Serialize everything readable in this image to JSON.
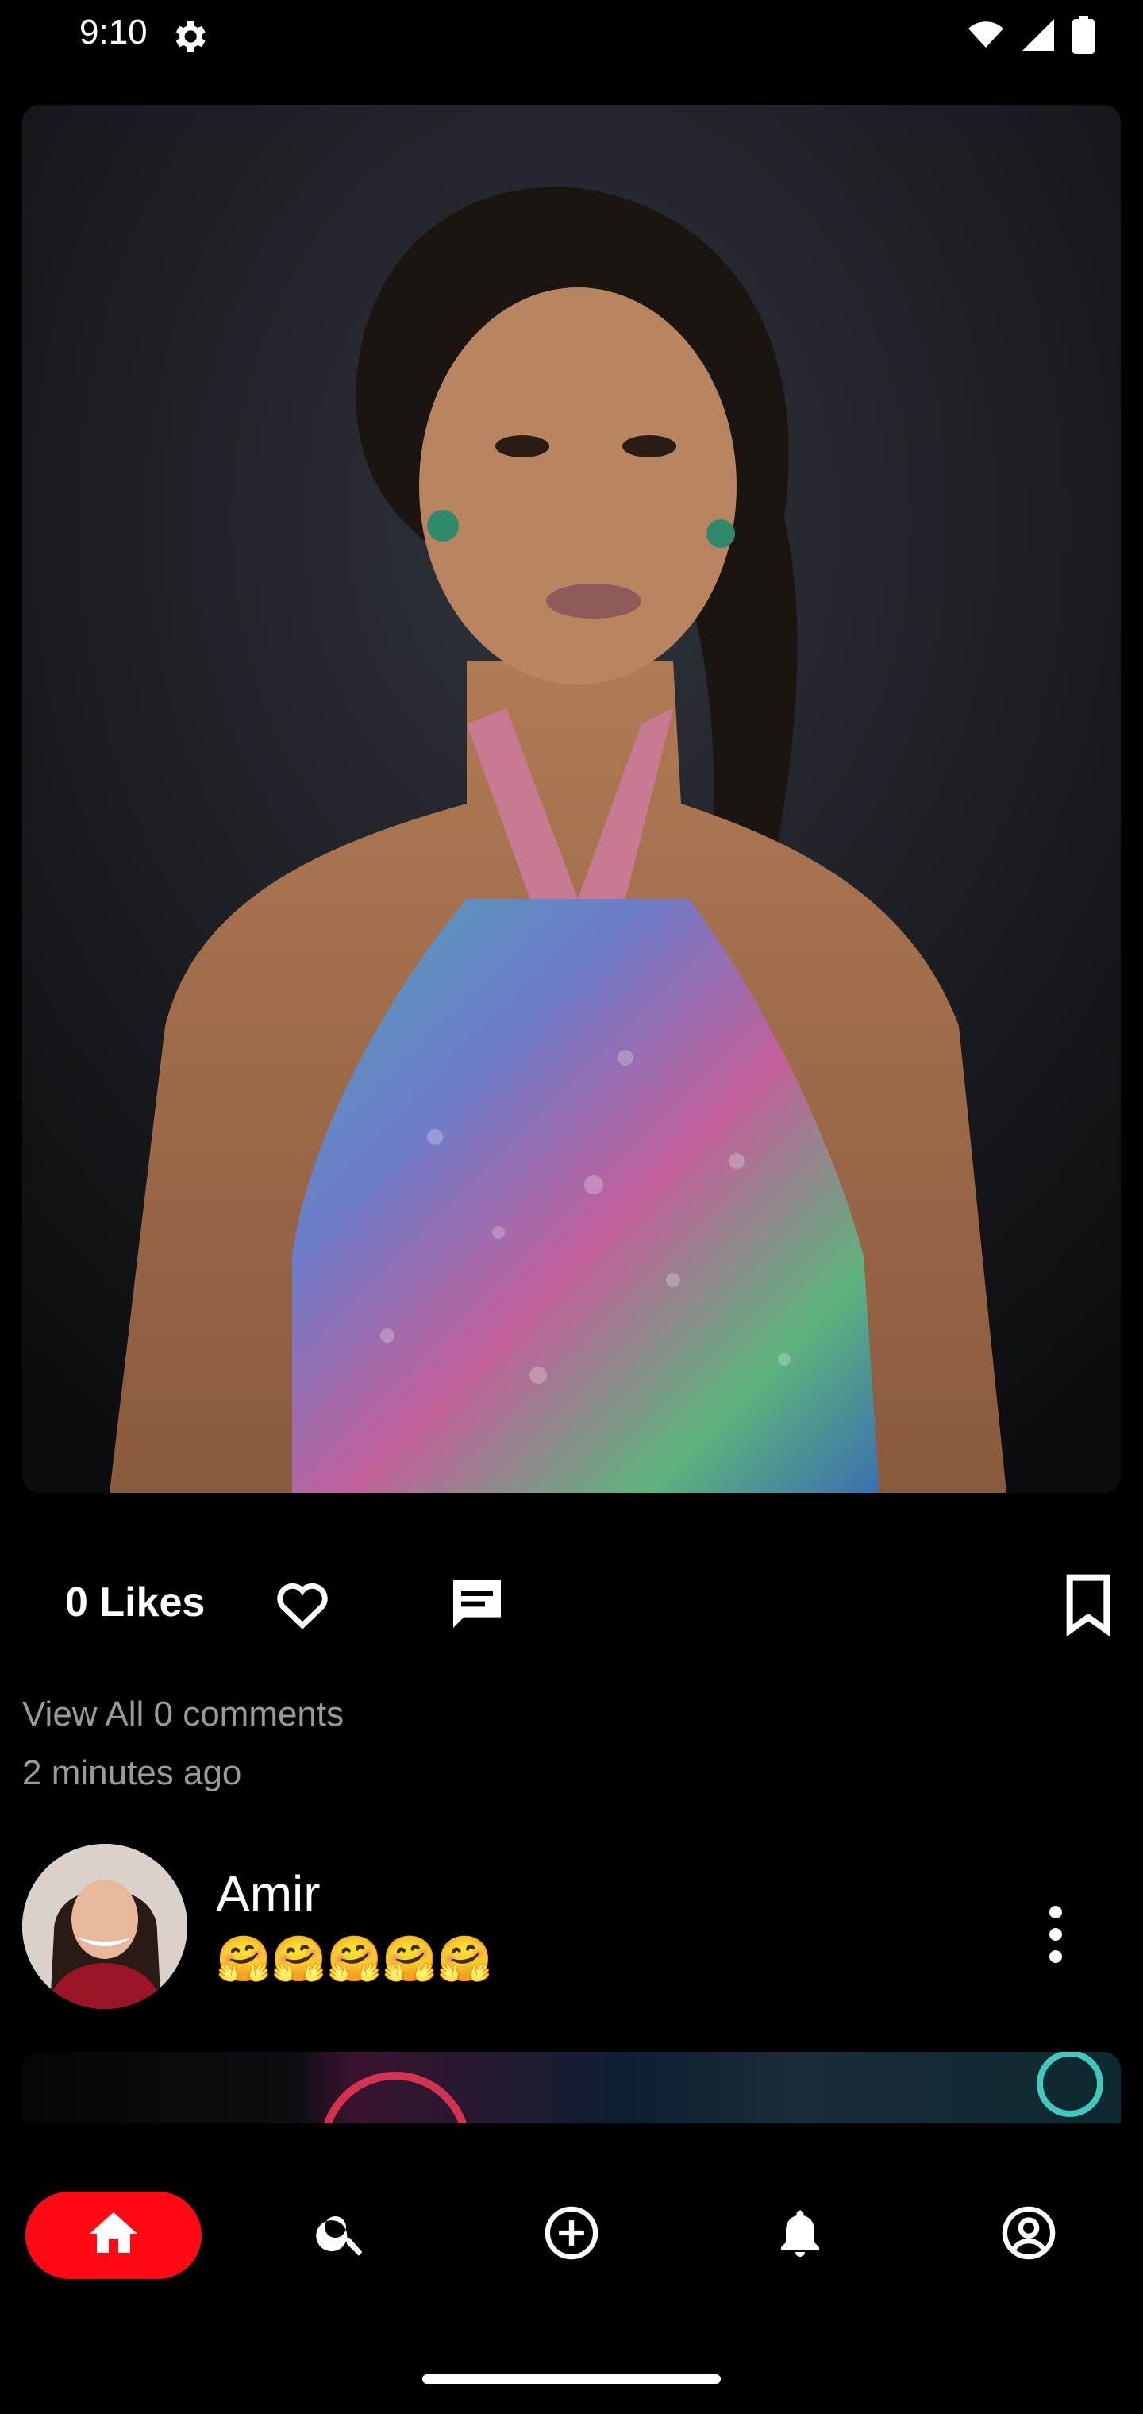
{
  "status_bar": {
    "time": "9:10"
  },
  "post": {
    "likes_text": "0 Likes",
    "view_comments_text": "View All 0 comments",
    "time_ago": "2 minutes ago"
  },
  "author": {
    "name": "Amir",
    "caption": "🤗🤗🤗🤗🤗"
  },
  "colors": {
    "accent": "#ff0a14",
    "background": "#000000",
    "muted_text": "#9a9a9a"
  },
  "nav": {
    "items": [
      "home-icon",
      "search-icon",
      "add-circle-icon",
      "bell-icon",
      "account-circle-icon"
    ],
    "active": "home"
  }
}
